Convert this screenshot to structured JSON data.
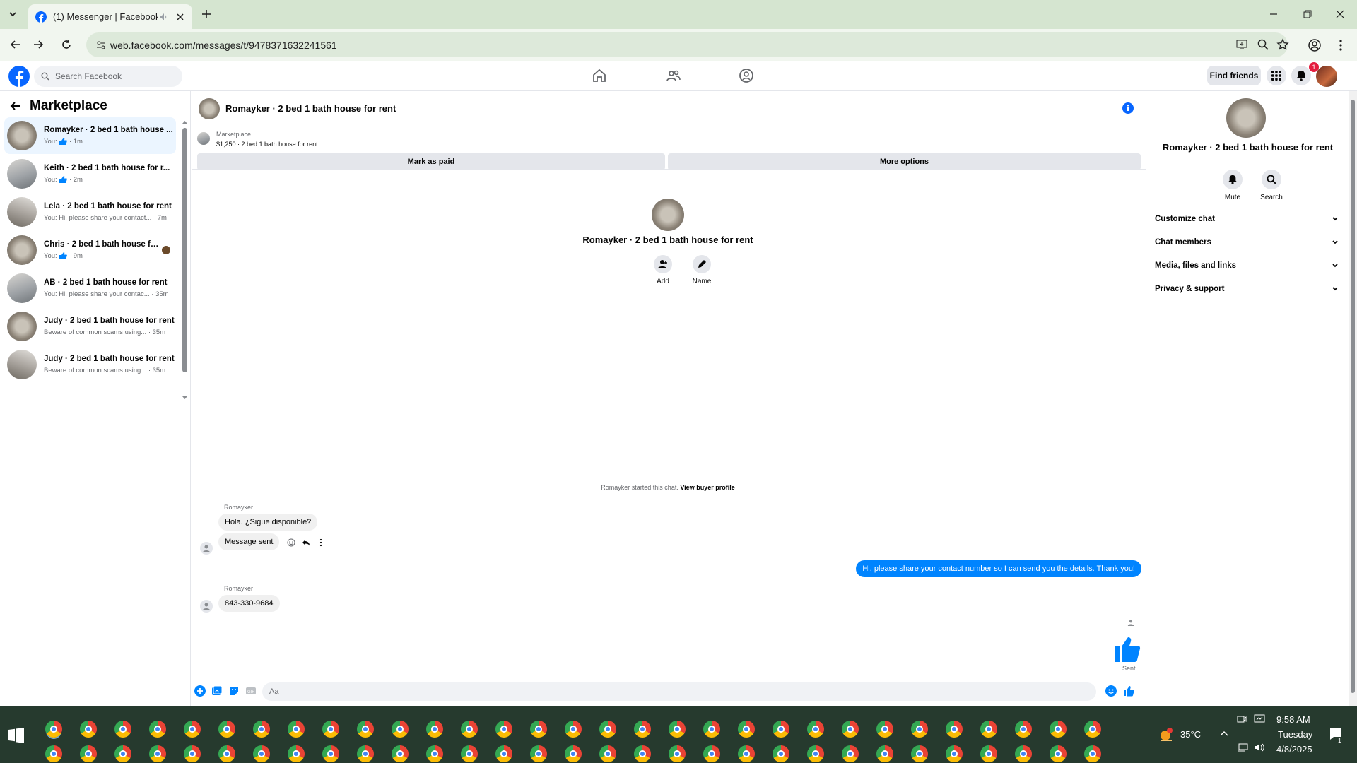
{
  "browser": {
    "tab_title": "(1) Messenger | Facebook",
    "url": "web.facebook.com/messages/t/9478371632241561"
  },
  "fb": {
    "search_placeholder": "Search Facebook",
    "find_friends": "Find friends",
    "notif_count": "1"
  },
  "left": {
    "title": "Marketplace",
    "conversations": [
      {
        "name": "Romayker · 2 bed 1 bath house ...",
        "preview_prefix": "You:",
        "preview": "· 1m",
        "thumb": true
      },
      {
        "name": "Keith · 2 bed 1 bath house for r...",
        "preview_prefix": "You:",
        "preview": "· 2m",
        "thumb": true
      },
      {
        "name": "Lela · 2 bed 1 bath house for rent",
        "preview_prefix": "",
        "preview": "You: Hi, please share your contact... · 7m",
        "thumb": false
      },
      {
        "name": "Chris · 2 bed 1 bath house for...",
        "preview_prefix": "You:",
        "preview": "· 9m",
        "thumb": true
      },
      {
        "name": "AB · 2 bed 1 bath house for rent",
        "preview_prefix": "",
        "preview": "You: Hi, please share your contac... · 35m",
        "thumb": false
      },
      {
        "name": "Judy · 2 bed 1 bath house for rent",
        "preview_prefix": "",
        "preview": "Beware of common scams using... · 35m",
        "thumb": false
      },
      {
        "name": "Judy · 2 bed 1 bath house for rent",
        "preview_prefix": "",
        "preview": "Beware of common scams using... · 35m",
        "thumb": false
      }
    ]
  },
  "chat": {
    "header_title": "Romayker · 2 bed 1 bath house for rent",
    "listing_source": "Marketplace",
    "listing_line": "$1,250 · 2 bed 1 bath house for rent",
    "mark_paid": "Mark as paid",
    "more_options": "More options",
    "center_name": "Romayker · 2 bed 1 bath house for rent",
    "add_label": "Add",
    "name_label": "Name",
    "started_text": "Romayker started this chat.",
    "view_buyer": "View buyer profile",
    "sender1": "Romayker",
    "msg1": "Hola. ¿Sigue disponible?",
    "msg2": "Message sent",
    "msg_out": "Hi, please share your contact number so I can send you the details. Thank you!",
    "sender2": "Romayker",
    "msg3": "843-330-9684",
    "sent_label": "Sent",
    "composer_placeholder": "Aa"
  },
  "right": {
    "name": "Romayker · 2 bed 1 bath house for rent",
    "mute": "Mute",
    "search": "Search",
    "sections": [
      "Customize chat",
      "Chat members",
      "Media, files and links",
      "Privacy & support"
    ]
  },
  "taskbar": {
    "temp": "35°C",
    "time": "9:58 AM",
    "day": "Tuesday",
    "date": "4/8/2025",
    "notif": "1"
  },
  "colors": {
    "fb_blue": "#0866ff",
    "messenger_blue": "#0084ff"
  }
}
